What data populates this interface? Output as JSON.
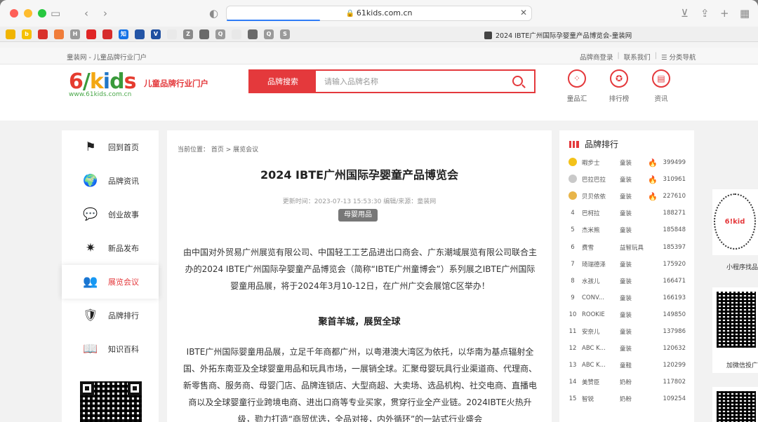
{
  "browser": {
    "url": "61kids.com.cn",
    "tab_title": "2024 IBTE广州国际孕婴童产品博览会-童装网",
    "bookmarks": [
      {
        "icon": "bookmark-yellow-icon",
        "color": "#f0b400",
        "text": ""
      },
      {
        "icon": "bookmark-b-icon",
        "color": "#f5c000",
        "text": "b"
      },
      {
        "icon": "bookmark-red-icon",
        "color": "#d9322b",
        "text": ""
      },
      {
        "icon": "bookmark-orange-icon",
        "color": "#f07d3a",
        "text": ""
      },
      {
        "icon": "bookmark-h-icon",
        "color": "#9a9a9a",
        "text": "H"
      },
      {
        "icon": "bookmark-red2-icon",
        "color": "#e02525",
        "text": ""
      },
      {
        "icon": "bookmark-red3-icon",
        "color": "#d62c2c",
        "text": ""
      },
      {
        "icon": "bookmark-zhi-icon",
        "color": "#1673e6",
        "text": "知"
      },
      {
        "icon": "bookmark-blue-icon",
        "color": "#2455a6",
        "text": ""
      },
      {
        "icon": "bookmark-v-icon",
        "color": "#1f4fa0",
        "text": "V"
      },
      {
        "icon": "bookmark-x-icon",
        "color": "#e9e9e9",
        "text": ""
      },
      {
        "icon": "bookmark-z-icon",
        "color": "#8a8a8a",
        "text": "Z"
      },
      {
        "icon": "bookmark-wechat-icon",
        "color": "#6a6a6a",
        "text": ""
      },
      {
        "icon": "bookmark-q-icon",
        "color": "#9a9a9a",
        "text": "Q"
      },
      {
        "icon": "bookmark-chrome-icon",
        "color": "#e8e8e8",
        "text": ""
      },
      {
        "icon": "bookmark-k-icon",
        "color": "#6a6a6a",
        "text": ""
      },
      {
        "icon": "bookmark-q2-icon",
        "color": "#9a9a9a",
        "text": "Q"
      },
      {
        "icon": "bookmark-s-icon",
        "color": "#9a9a9a",
        "text": "S"
      }
    ]
  },
  "topnav": {
    "breadcrumb": "童装网 - 儿童品牌行业门户",
    "login": "品牌商登录",
    "contact": "联系我们",
    "sep": "|",
    "category": "☰ 分类导航"
  },
  "header": {
    "logo_text": [
      "6",
      "/",
      "k",
      "i",
      "d",
      "s"
    ],
    "logo_sub": "www.61kids.com.cn",
    "slogan": "儿童品牌行业门户",
    "search_btn": "品牌搜索",
    "search_placeholder": "请输入品牌名称",
    "icons": [
      {
        "label": "童品汇",
        "icon": "dots-icon"
      },
      {
        "label": "排行榜",
        "icon": "medal-icon"
      },
      {
        "label": "资讯",
        "icon": "news-icon"
      }
    ]
  },
  "leftnav": [
    {
      "label": "回到首页",
      "icon": "flag-icon",
      "glyph": "⚑",
      "active": false
    },
    {
      "label": "品牌资讯",
      "icon": "globe-icon",
      "glyph": "🌍",
      "active": false
    },
    {
      "label": "创业故事",
      "icon": "chat-icon",
      "glyph": "💬",
      "active": false
    },
    {
      "label": "新品发布",
      "icon": "sparkle-icon",
      "glyph": "✷",
      "active": false
    },
    {
      "label": "展览会议",
      "icon": "people-icon",
      "glyph": "👥",
      "active": true
    },
    {
      "label": "品牌排行",
      "icon": "shield-icon",
      "glyph": "🛡",
      "active": false
    },
    {
      "label": "知识百科",
      "icon": "book-icon",
      "glyph": "📖",
      "active": false
    }
  ],
  "article": {
    "crumb": "当前位置： 首页 > 展览会议",
    "title": "2024 IBTE广州国际孕婴童产品博览会",
    "meta": "更新时间：2023-07-13 15:53:30   编辑/来源：童装网",
    "tag": "母婴用品",
    "para1": "由中国对外贸易广州展览有限公司、中国轻工工艺品进出口商会、广东潮域展览有限公司联合主办的2024 IBTE广州国际孕婴童产品博览会（简称“IBTE广州童博会”）系列展之IBTE广州国际婴童用品展，将于2024年3月10-12日，在广州广交会展馆C区举办！",
    "subhead": "聚首羊城，展贸全球",
    "para2": "IBTE广州国际婴童用品展，立足千年商都广州，以粤港澳大湾区为依托，以华南为基点辐射全国、外拓东南亚及全球婴童用品和玩具市场，一展销全球。汇聚母婴玩具行业渠道商、代理商、新零售商、服务商、母婴门店、品牌连锁店、大型商超、大卖场、选品机构、社交电商、直播电商以及全球婴童行业跨境电商、进出口商等专业买家，贯穿行业全产业链。2024IBTE火热升级，勠力打造“商贸优选，全品对接，内外循环”的一站式行业盛会"
  },
  "ranking": {
    "title": "品牌排行",
    "rows": [
      {
        "num": "",
        "medal": "#f3c21a",
        "name": "暇步士",
        "cat": "童装",
        "hot": true,
        "score": "399499"
      },
      {
        "num": "",
        "medal": "#c9c9c9",
        "name": "巴拉巴拉",
        "cat": "童装",
        "hot": true,
        "score": "310961"
      },
      {
        "num": "",
        "medal": "#e8b54a",
        "name": "贝贝依依",
        "cat": "童装",
        "hot": true,
        "score": "227610"
      },
      {
        "num": "4",
        "medal": "",
        "name": "巴柯拉",
        "cat": "童装",
        "hot": false,
        "score": "188271"
      },
      {
        "num": "5",
        "medal": "",
        "name": "杰米熊",
        "cat": "童装",
        "hot": false,
        "score": "185848"
      },
      {
        "num": "6",
        "medal": "",
        "name": "费雪",
        "cat": "益智玩具",
        "hot": false,
        "score": "185397"
      },
      {
        "num": "7",
        "medal": "",
        "name": "琦瑞德泽",
        "cat": "童装",
        "hot": false,
        "score": "175920"
      },
      {
        "num": "8",
        "medal": "",
        "name": "水孩儿",
        "cat": "童装",
        "hot": false,
        "score": "166471"
      },
      {
        "num": "9",
        "medal": "",
        "name": "CONV...",
        "cat": "童装",
        "hot": false,
        "score": "166193"
      },
      {
        "num": "10",
        "medal": "",
        "name": "ROOKIE",
        "cat": "童装",
        "hot": false,
        "score": "149850"
      },
      {
        "num": "11",
        "medal": "",
        "name": "安奈儿",
        "cat": "童装",
        "hot": false,
        "score": "137986"
      },
      {
        "num": "12",
        "medal": "",
        "name": "ABC K...",
        "cat": "童装",
        "hot": false,
        "score": "120632"
      },
      {
        "num": "13",
        "medal": "",
        "name": "ABC K...",
        "cat": "童鞋",
        "hot": false,
        "score": "120299"
      },
      {
        "num": "14",
        "medal": "",
        "name": "美赞臣",
        "cat": "奶粉",
        "hot": false,
        "score": "117802"
      },
      {
        "num": "15",
        "medal": "",
        "name": "智锐",
        "cat": "奶粉",
        "hot": false,
        "score": "109254"
      }
    ]
  },
  "side": {
    "mini_label": "小程序找品",
    "wx_label": "加微信投广",
    "mini_code_text": "6!kid"
  }
}
